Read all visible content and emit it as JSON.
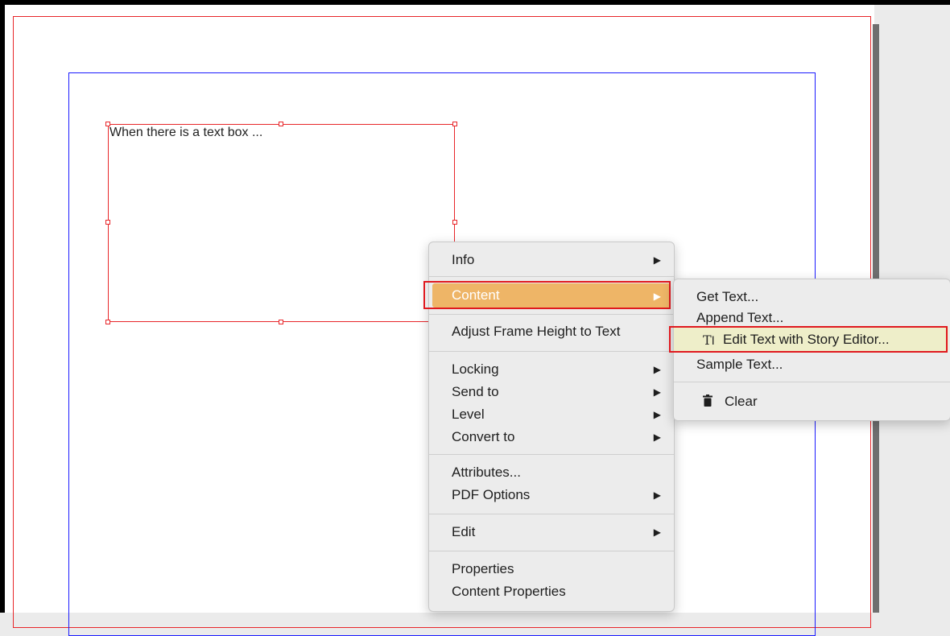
{
  "document": {
    "frame_text": "When there is a text box ..."
  },
  "context_menu": {
    "items": [
      {
        "label": "Info",
        "submenu": true
      },
      {
        "label": "Content",
        "submenu": true
      },
      {
        "label": "Adjust Frame Height to Text",
        "submenu": false
      },
      {
        "label": "Locking",
        "submenu": true
      },
      {
        "label": "Send to",
        "submenu": true
      },
      {
        "label": "Level",
        "submenu": true
      },
      {
        "label": "Convert to",
        "submenu": true
      },
      {
        "label": "Attributes...",
        "submenu": false
      },
      {
        "label": "PDF Options",
        "submenu": true
      },
      {
        "label": "Edit",
        "submenu": true
      },
      {
        "label": "Properties",
        "submenu": false
      },
      {
        "label": "Content Properties",
        "submenu": false
      }
    ],
    "highlighted": "Content"
  },
  "content_submenu": {
    "items": [
      {
        "label": "Get Text...",
        "icon": ""
      },
      {
        "label": "Append Text...",
        "icon": ""
      },
      {
        "label": "Edit Text with Story Editor...",
        "icon": "story-editor-icon"
      },
      {
        "label": "Sample Text...",
        "icon": ""
      },
      {
        "label": "Clear",
        "icon": "trash-icon"
      }
    ],
    "highlighted": "Edit Text with Story Editor..."
  },
  "colors": {
    "bleed_guide": "#e8262a",
    "margin_guide": "#1b1bff",
    "menu_highlight": "#eeb567",
    "submenu_highlight": "#eeeec9",
    "callout": "#e0191f"
  }
}
